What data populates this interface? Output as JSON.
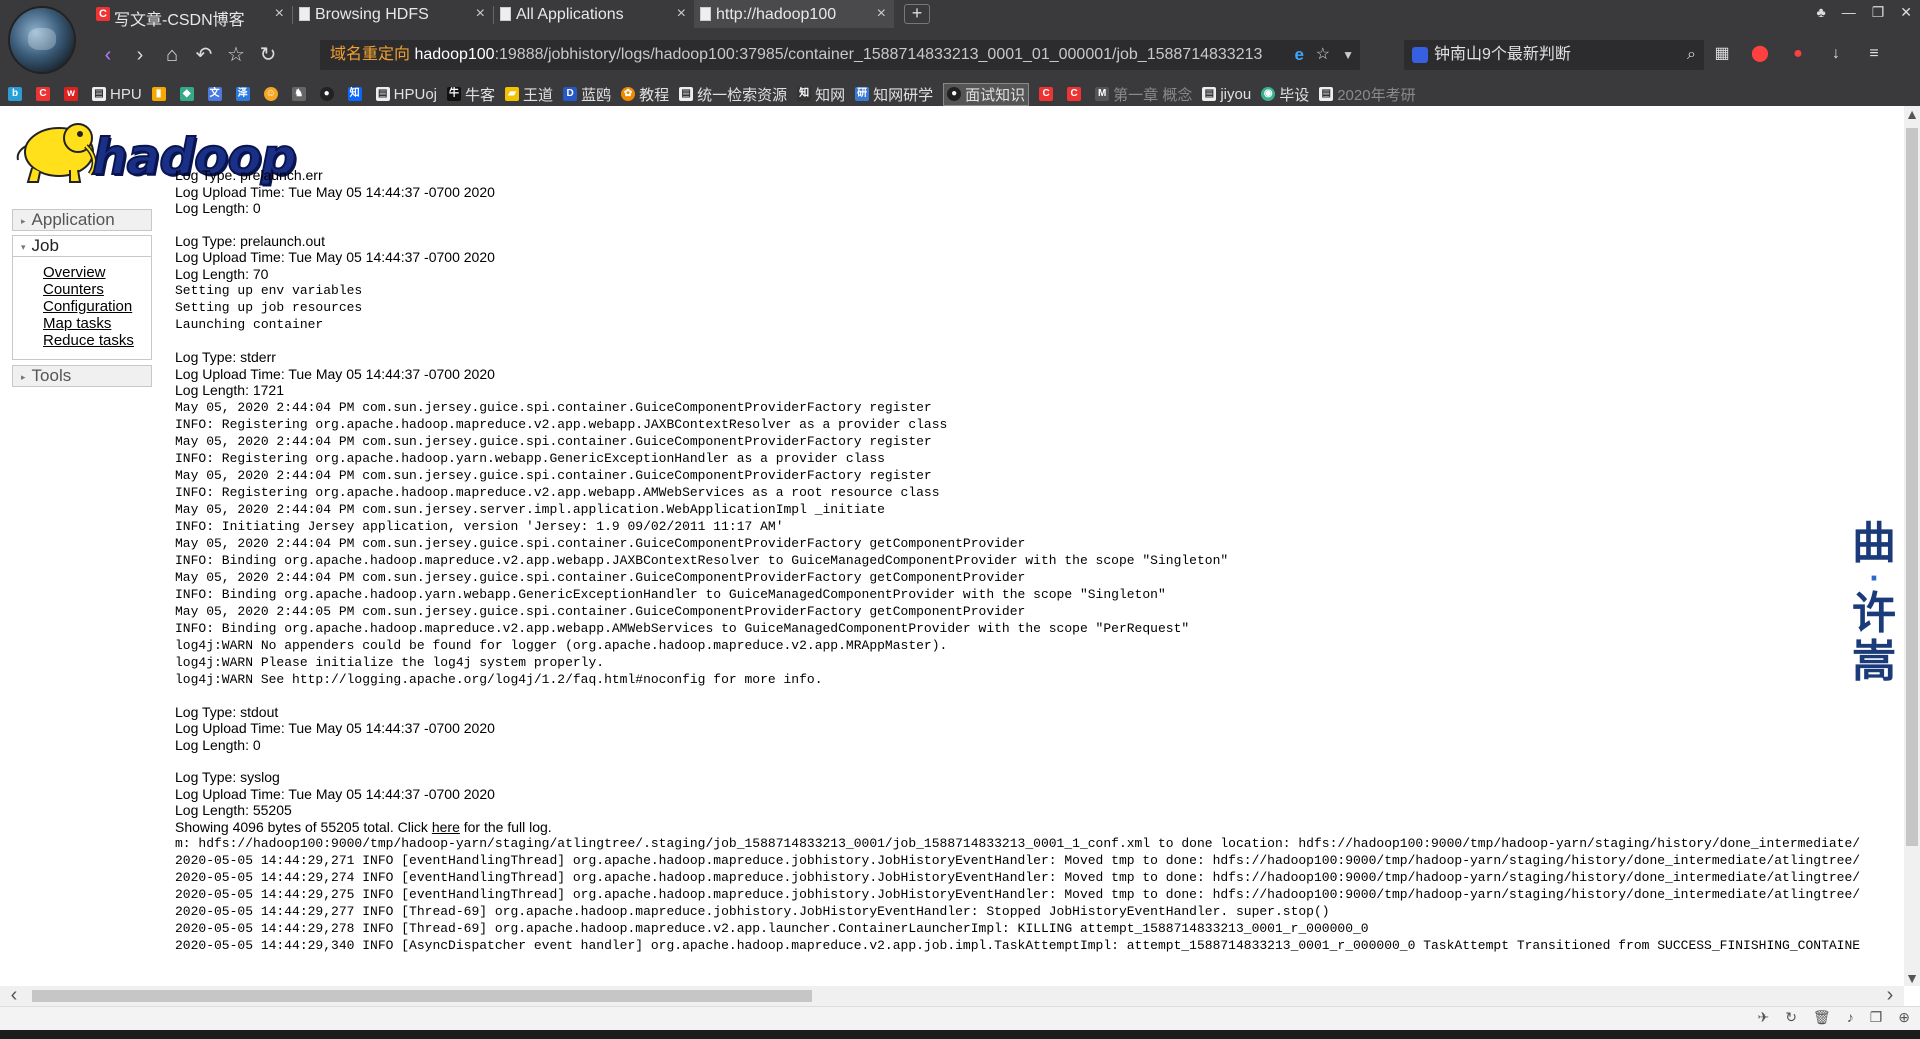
{
  "browser": {
    "tabs": [
      {
        "title": "写文章-CSDN博客",
        "icon": "csdn",
        "active": false
      },
      {
        "title": "Browsing HDFS",
        "icon": "page",
        "active": false
      },
      {
        "title": "All Applications",
        "icon": "page",
        "active": false
      },
      {
        "title": "http://hadoop100",
        "icon": "page",
        "active": true
      }
    ],
    "new_tab": "+",
    "address": {
      "redirect": "域名重定向",
      "host": "hadoop100",
      "path": ":19888/jobhistory/logs/hadoop100:37985/container_1588714833213_0001_01_000001/job_1588714833213"
    },
    "search": {
      "value": "钟南山9个最新判断"
    },
    "bookmarks": [
      {
        "label": "",
        "icon": "bilibili"
      },
      {
        "label": "",
        "icon": "csdn"
      },
      {
        "label": "",
        "icon": "weibo"
      },
      {
        "label": "HPU",
        "icon": "folder"
      },
      {
        "label": "",
        "icon": "chart"
      },
      {
        "label": "",
        "icon": "chat"
      },
      {
        "label": "",
        "icon": "translate"
      },
      {
        "label": "",
        "icon": "ze"
      },
      {
        "label": "",
        "icon": "smile"
      },
      {
        "label": "",
        "icon": "wolf"
      },
      {
        "label": "",
        "icon": "github"
      },
      {
        "label": "",
        "icon": "zhihu"
      },
      {
        "label": "HPUoj",
        "icon": "folder"
      },
      {
        "label": "牛客",
        "icon": "niuke"
      },
      {
        "label": "王道",
        "icon": "wangdao"
      },
      {
        "label": "蓝鸥",
        "icon": "lanou"
      },
      {
        "label": "教程",
        "icon": "tutorial"
      },
      {
        "label": "统一检索资源",
        "icon": "folder"
      },
      {
        "label": "知网",
        "icon": "cnki"
      },
      {
        "label": "知网研学",
        "icon": "yanxue"
      },
      {
        "label": "面试知识",
        "icon": "github"
      },
      {
        "label": "",
        "icon": "csdn"
      },
      {
        "label": "",
        "icon": "csdn"
      },
      {
        "label": "第一章 概念",
        "icon": "mooc"
      },
      {
        "label": "jiyou",
        "icon": "folder"
      },
      {
        "label": "毕设",
        "icon": "bishe"
      },
      {
        "label": "2020年考研",
        "icon": "folder"
      }
    ]
  },
  "page": {
    "logo_text": "hadoop",
    "sidebar": {
      "application": "Application",
      "job": "Job",
      "job_links": [
        "Overview",
        "Counters",
        "Configuration",
        "Map tasks",
        "Reduce tasks"
      ],
      "tools": "Tools"
    },
    "logs": [
      {
        "type": "Log Type: prelaunch.err",
        "upload": "Log Upload Time: Tue May 05 14:44:37 -0700 2020",
        "length": "Log Length: 0",
        "content": ""
      },
      {
        "type": "Log Type: prelaunch.out",
        "upload": "Log Upload Time: Tue May 05 14:44:37 -0700 2020",
        "length": "Log Length: 70",
        "content": "Setting up env variables\nSetting up job resources\nLaunching container"
      },
      {
        "type": "Log Type: stderr",
        "upload": "Log Upload Time: Tue May 05 14:44:37 -0700 2020",
        "length": "Log Length: 1721",
        "content": "May 05, 2020 2:44:04 PM com.sun.jersey.guice.spi.container.GuiceComponentProviderFactory register\nINFO: Registering org.apache.hadoop.mapreduce.v2.app.webapp.JAXBContextResolver as a provider class\nMay 05, 2020 2:44:04 PM com.sun.jersey.guice.spi.container.GuiceComponentProviderFactory register\nINFO: Registering org.apache.hadoop.yarn.webapp.GenericExceptionHandler as a provider class\nMay 05, 2020 2:44:04 PM com.sun.jersey.guice.spi.container.GuiceComponentProviderFactory register\nINFO: Registering org.apache.hadoop.mapreduce.v2.app.webapp.AMWebServices as a root resource class\nMay 05, 2020 2:44:04 PM com.sun.jersey.server.impl.application.WebApplicationImpl _initiate\nINFO: Initiating Jersey application, version 'Jersey: 1.9 09/02/2011 11:17 AM'\nMay 05, 2020 2:44:04 PM com.sun.jersey.guice.spi.container.GuiceComponentProviderFactory getComponentProvider\nINFO: Binding org.apache.hadoop.mapreduce.v2.app.webapp.JAXBContextResolver to GuiceManagedComponentProvider with the scope \"Singleton\"\nMay 05, 2020 2:44:04 PM com.sun.jersey.guice.spi.container.GuiceComponentProviderFactory getComponentProvider\nINFO: Binding org.apache.hadoop.yarn.webapp.GenericExceptionHandler to GuiceManagedComponentProvider with the scope \"Singleton\"\nMay 05, 2020 2:44:05 PM com.sun.jersey.guice.spi.container.GuiceComponentProviderFactory getComponentProvider\nINFO: Binding org.apache.hadoop.mapreduce.v2.app.webapp.AMWebServices to GuiceManagedComponentProvider with the scope \"PerRequest\"\nlog4j:WARN No appenders could be found for logger (org.apache.hadoop.mapreduce.v2.app.MRAppMaster).\nlog4j:WARN Please initialize the log4j system properly.\nlog4j:WARN See http://logging.apache.org/log4j/1.2/faq.html#noconfig for more info."
      },
      {
        "type": "Log Type: stdout",
        "upload": "Log Upload Time: Tue May 05 14:44:37 -0700 2020",
        "length": "Log Length: 0",
        "content": ""
      },
      {
        "type": "Log Type: syslog",
        "upload": "Log Upload Time: Tue May 05 14:44:37 -0700 2020",
        "length": "Log Length: 55205",
        "showing_prefix": "Showing 4096 bytes of 55205 total. Click ",
        "showing_link": "here",
        "showing_suffix": " for the full log.",
        "content": "m: hdfs://hadoop100:9000/tmp/hadoop-yarn/staging/atlingtree/.staging/job_1588714833213_0001/job_1588714833213_0001_1_conf.xml to done location: hdfs://hadoop100:9000/tmp/hadoop-yarn/staging/history/done_intermediate/\n2020-05-05 14:44:29,271 INFO [eventHandlingThread] org.apache.hadoop.mapreduce.jobhistory.JobHistoryEventHandler: Moved tmp to done: hdfs://hadoop100:9000/tmp/hadoop-yarn/staging/history/done_intermediate/atlingtree/\n2020-05-05 14:44:29,274 INFO [eventHandlingThread] org.apache.hadoop.mapreduce.jobhistory.JobHistoryEventHandler: Moved tmp to done: hdfs://hadoop100:9000/tmp/hadoop-yarn/staging/history/done_intermediate/atlingtree/\n2020-05-05 14:44:29,275 INFO [eventHandlingThread] org.apache.hadoop.mapreduce.jobhistory.JobHistoryEventHandler: Moved tmp to done: hdfs://hadoop100:9000/tmp/hadoop-yarn/staging/history/done_intermediate/atlingtree/\n2020-05-05 14:44:29,277 INFO [Thread-69] org.apache.hadoop.mapreduce.jobhistory.JobHistoryEventHandler: Stopped JobHistoryEventHandler. super.stop()\n2020-05-05 14:44:29,278 INFO [Thread-69] org.apache.hadoop.mapreduce.v2.app.launcher.ContainerLauncherImpl: KILLING attempt_1588714833213_0001_r_000000_0\n2020-05-05 14:44:29,340 INFO [AsyncDispatcher event handler] org.apache.hadoop.mapreduce.v2.app.job.impl.TaskAttemptImpl: attempt_1588714833213_0001_r_000000_0 TaskAttempt Transitioned from SUCCESS_FINISHING_CONTAINE"
      }
    ]
  },
  "overlay": {
    "chars": [
      "曲",
      "·",
      "许",
      "嵩"
    ]
  }
}
